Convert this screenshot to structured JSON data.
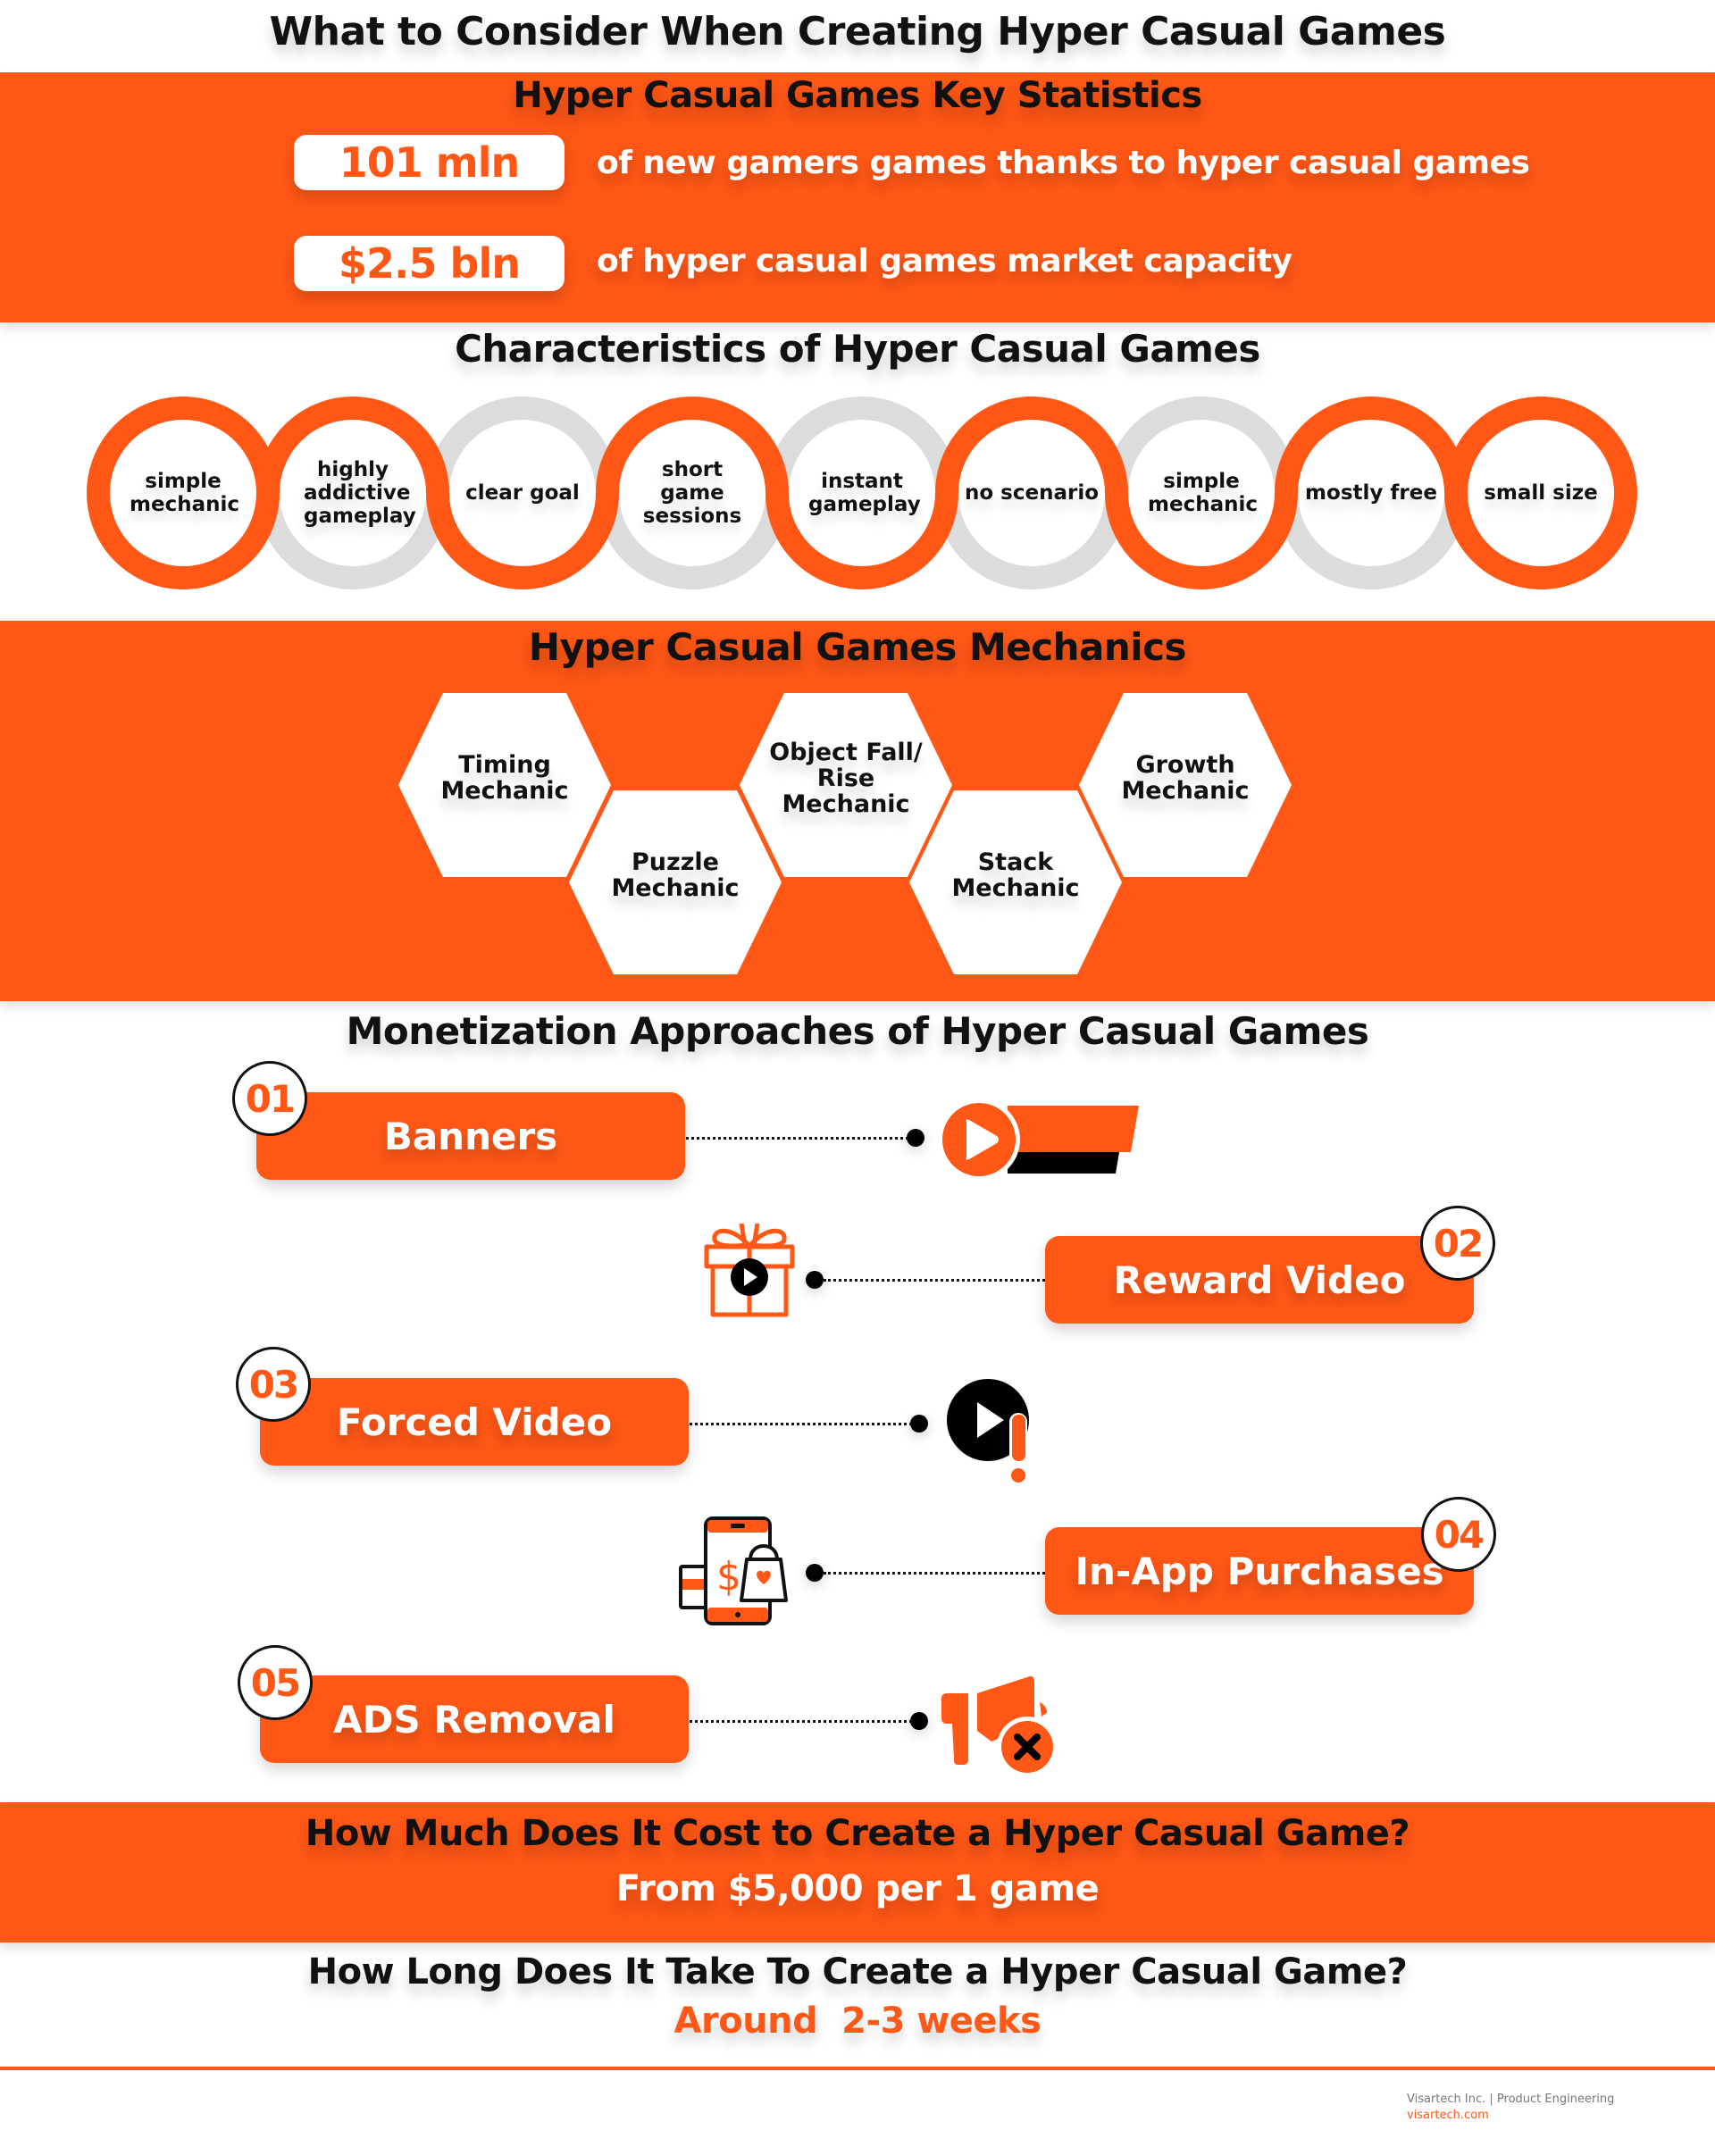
{
  "title": "What to Consider When Creating Hyper Casual Games",
  "colors": {
    "accent": "#fe5716",
    "ring_gray": "#dcdcdc",
    "dark": "#111111"
  },
  "key_statistics": {
    "title": "Hyper Casual Games Key Statistics",
    "items": [
      {
        "value": "101 mln",
        "description": "of new gamers games thanks to hyper casual games"
      },
      {
        "value": "$2.5 bln",
        "description": "of hyper casual games market capacity"
      }
    ]
  },
  "characteristics": {
    "title": "Characteristics of Hyper Casual Games",
    "items": [
      {
        "label": "simple mechanic"
      },
      {
        "label": "highly addictive gameplay"
      },
      {
        "label": "clear goal"
      },
      {
        "label": "short game sessions"
      },
      {
        "label": "instant gameplay"
      },
      {
        "label": "no scenario"
      },
      {
        "label": "simple mechanic"
      },
      {
        "label": "mostly free"
      },
      {
        "label": "small size"
      }
    ]
  },
  "mechanics": {
    "title": "Hyper Casual Games Mechanics",
    "items": [
      {
        "label": "Timing Mechanic"
      },
      {
        "label": "Puzzle Mechanic"
      },
      {
        "label": "Object Fall/ Rise Mechanic"
      },
      {
        "label": "Stack Mechanic"
      },
      {
        "label": "Growth Mechanic"
      }
    ]
  },
  "monetization": {
    "title": "Monetization Approaches of Hyper Casual Games",
    "items": [
      {
        "number": "01",
        "label": "Banners",
        "icon": "video-banner-icon"
      },
      {
        "number": "02",
        "label": "Reward Video",
        "icon": "gift-video-icon"
      },
      {
        "number": "03",
        "label": "Forced Video",
        "icon": "forced-video-alert-icon"
      },
      {
        "number": "04",
        "label": "In-App Purchases",
        "icon": "phone-shopping-bag-icon"
      },
      {
        "number": "05",
        "label": "ADS Removal",
        "icon": "megaphone-remove-icon"
      }
    ]
  },
  "cost": {
    "question": "How Much Does It Cost to Create a Hyper Casual Game?",
    "answer": "From $5,000 per 1 game"
  },
  "time": {
    "question": "How Long Does It Take To Create a Hyper Casual Game?",
    "answer": "Around  2-3 weeks"
  },
  "footer": {
    "company": "Visartech Inc. | Product Engineering",
    "url": "visartech.com"
  }
}
